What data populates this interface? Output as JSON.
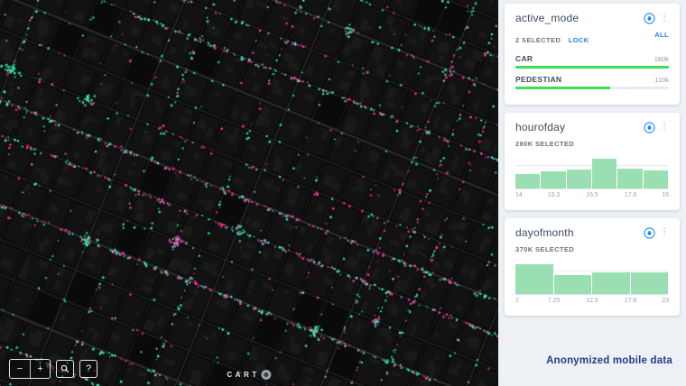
{
  "app": {
    "footer_note": "Anonymized mobile data"
  },
  "map": {
    "background": "#0a0a0a",
    "logo_text": "CART",
    "point_colors": {
      "green": "#35eca6",
      "pink": "#ff2f9c"
    },
    "controls": {
      "zoom_out": "−",
      "zoom_in": "+",
      "help": "?"
    }
  },
  "widgets": [
    {
      "title": "active_mode",
      "selected_text": "2 SELECTED",
      "lock_label": "LOCK",
      "all_label": "ALL"
    },
    {
      "title": "hourofday",
      "selected_text": "280K SELECTED"
    },
    {
      "title": "dayofmonth",
      "selected_text": "370K SELECTED"
    }
  ],
  "chart_data": [
    {
      "type": "bar",
      "widget": "active_mode",
      "categories": [
        "CAR",
        "PEDESTIAN"
      ],
      "values": [
        160000,
        110000
      ],
      "value_labels": [
        "160k",
        "110k"
      ],
      "bar_pct": [
        100,
        62
      ],
      "bar_color": "#3bdf52",
      "track_color": "#e7ebef"
    },
    {
      "type": "bar",
      "widget": "hourofday",
      "x_ticks": [
        "14",
        "15.3",
        "16.5",
        "17.8",
        "19"
      ],
      "xlim": [
        14,
        19
      ],
      "values_relative_pct": [
        50,
        57,
        65,
        100,
        68,
        60
      ],
      "bar_color": "#9adfb2",
      "gridline_pct_from_bottom": 76
    },
    {
      "type": "bar",
      "widget": "dayofmonth",
      "x_ticks": [
        "2",
        "7.25",
        "12.5",
        "17.8",
        "23"
      ],
      "xlim": [
        2,
        23
      ],
      "values_relative_pct": [
        100,
        65,
        72,
        74
      ],
      "bar_color": "#9adfb2",
      "gridline_pct_from_bottom": 76
    }
  ]
}
